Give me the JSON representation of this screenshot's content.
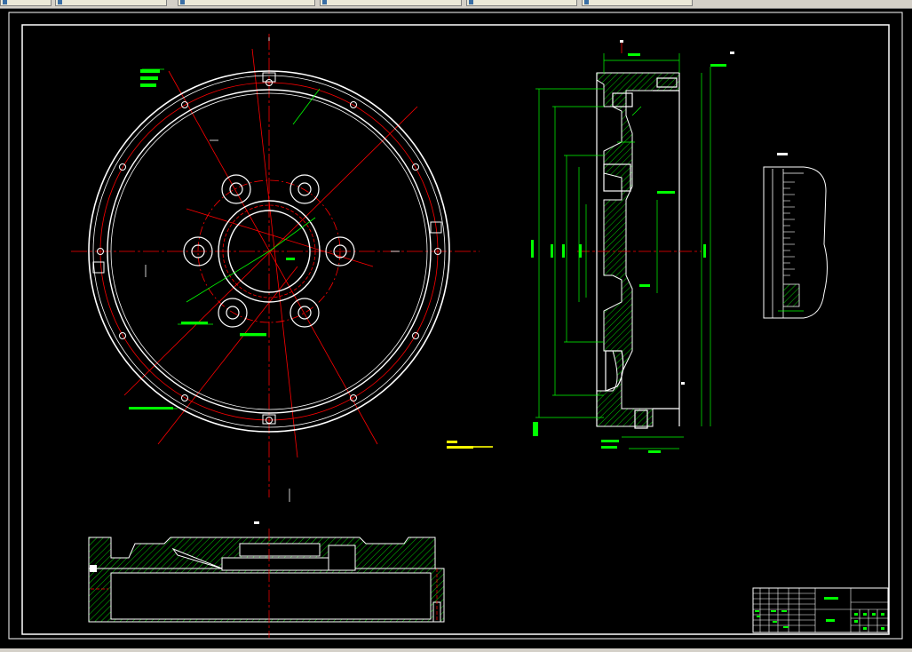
{
  "taskbar": {
    "tabs": [
      "",
      "",
      "",
      "",
      "",
      ""
    ]
  },
  "drawing": {
    "title_block_name": "",
    "title_block_code": "",
    "section_label": "",
    "tech_req_heading": "",
    "tech_req_text": "",
    "colors": {
      "background": "#000000",
      "outline": "#ffffff",
      "centerline": "#ff0000",
      "dimension": "#00ff00",
      "hatch": "#00ff00",
      "note": "#ffff00",
      "frame": "#ffffff"
    }
  }
}
